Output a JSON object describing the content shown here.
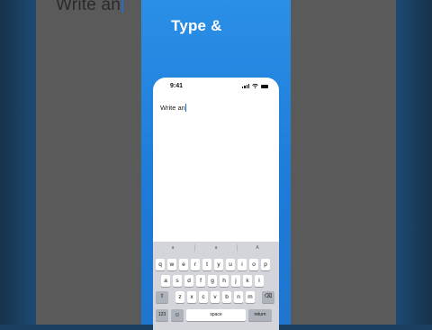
{
  "background_text": "Write an",
  "header": {
    "title": "Type &"
  },
  "phone": {
    "status": {
      "time": "9:41"
    },
    "document_text": "Write an"
  },
  "keyboard": {
    "predictions": [
      "a  ",
      "a",
      "A  "
    ],
    "row1": [
      "q",
      "w",
      "e",
      "r",
      "t",
      "y",
      "u",
      "i",
      "o",
      "p"
    ],
    "row2": [
      "a",
      "s",
      "d",
      "f",
      "g",
      "h",
      "j",
      "k",
      "l"
    ],
    "row3": [
      "z",
      "x",
      "c",
      "v",
      "b",
      "n",
      "m"
    ],
    "shift": "⇧",
    "backspace": "⌫",
    "numbers": "123",
    "emoji": "☺",
    "space": "space",
    "return": "return"
  },
  "colors": {
    "accent": "#1f7ad8",
    "caret": "#1f6fd0"
  }
}
